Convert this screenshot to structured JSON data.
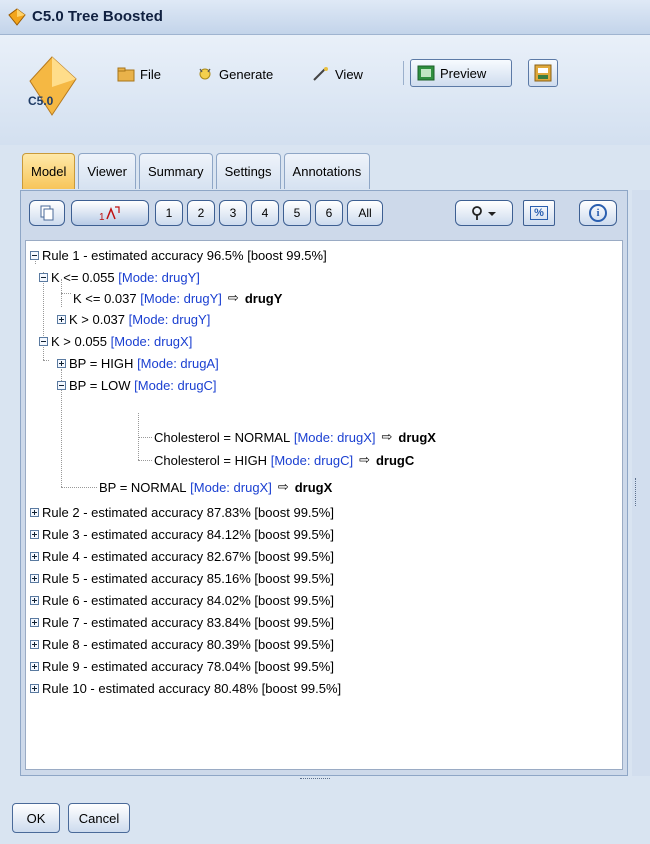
{
  "window": {
    "title": "C5.0 Tree Boosted",
    "logo_text": "C5.0"
  },
  "toolbar": {
    "file": "File",
    "generate": "Generate",
    "view": "View",
    "preview": "Preview"
  },
  "tabs": [
    {
      "label": "Model",
      "active": true
    },
    {
      "label": "Viewer"
    },
    {
      "label": "Summary"
    },
    {
      "label": "Settings"
    },
    {
      "label": "Annotations"
    }
  ],
  "subtoolbar": {
    "levels": [
      "1",
      "2",
      "3",
      "4",
      "5",
      "6",
      "All"
    ],
    "percent_label": "%",
    "info_label": "i"
  },
  "tree": {
    "rule1": "Rule 1 - estimated accuracy 96.5% [boost 99.5%]",
    "k1": "K <= 0.055",
    "k1_mode": "[Mode: drugY]",
    "k11": "K <= 0.037",
    "k11_mode": "[Mode: drugY]",
    "k11_pred": "drugY",
    "k12": "K > 0.037",
    "k12_mode": "[Mode: drugY]",
    "k2": "K > 0.055",
    "k2_mode": "[Mode: drugX]",
    "bp_high": "BP = HIGH",
    "bp_high_mode": "[Mode: drugA]",
    "bp_low": "BP = LOW",
    "bp_low_mode": "[Mode: drugC]",
    "chol_normal": "Cholesterol = NORMAL",
    "chol_normal_mode": "[Mode: drugX]",
    "chol_normal_pred": "drugX",
    "chol_high": "Cholesterol = HIGH",
    "chol_high_mode": "[Mode: drugC]",
    "chol_high_pred": "drugC",
    "bp_normal": "BP = NORMAL",
    "bp_normal_mode": "[Mode: drugX]",
    "bp_normal_pred": "drugX",
    "arrow": "⇨",
    "rules": [
      "Rule 2 - estimated accuracy 87.83% [boost 99.5%]",
      "Rule 3 - estimated accuracy 84.12% [boost 99.5%]",
      "Rule 4 - estimated accuracy 82.67% [boost 99.5%]",
      "Rule 5 - estimated accuracy 85.16% [boost 99.5%]",
      "Rule 6 - estimated accuracy 84.02% [boost 99.5%]",
      "Rule 7 - estimated accuracy 83.84% [boost 99.5%]",
      "Rule 8 - estimated accuracy 80.39% [boost 99.5%]",
      "Rule 9 - estimated accuracy 78.04% [boost 99.5%]",
      "Rule 10 - estimated accuracy 80.48% [boost 99.5%]"
    ]
  },
  "footer": {
    "ok": "OK",
    "cancel": "Cancel"
  },
  "colors": {
    "mode_text": "#1a3fd1",
    "active_tab": "#f7c55a"
  }
}
